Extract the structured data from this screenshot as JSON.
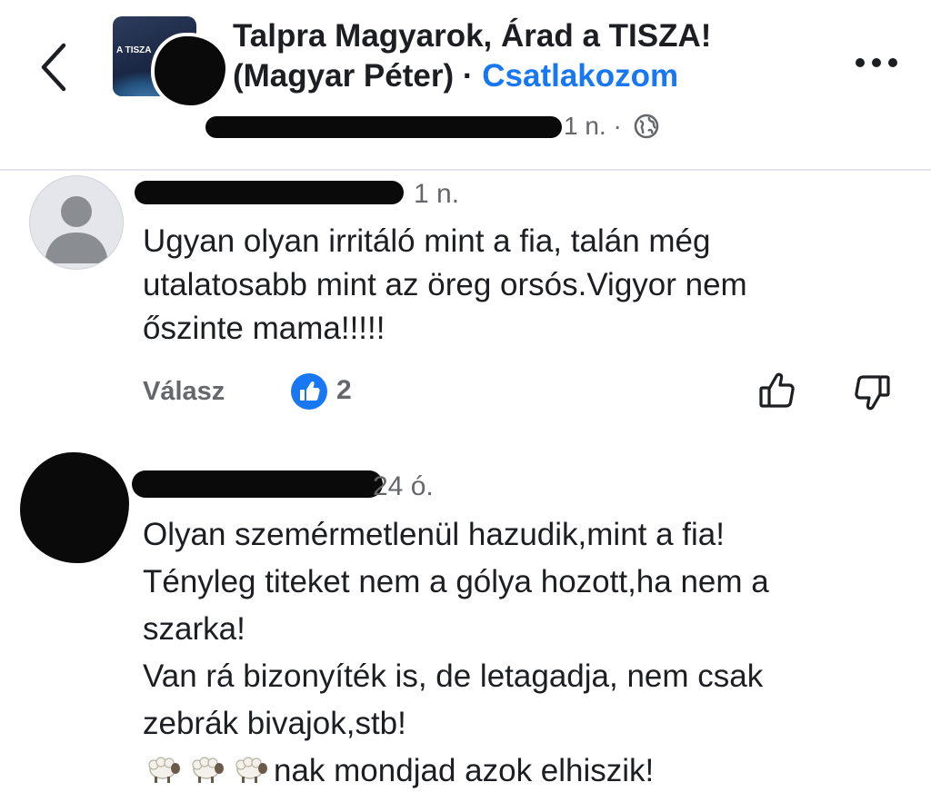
{
  "header": {
    "group_title_line1": "Talpra Magyarok, Árad a TISZA!",
    "group_title_line2": "(Magyar Péter)",
    "separator": " · ",
    "join_label": "Csatlakozom",
    "thumbnail_text": "A TISZA",
    "post_time": "1 n.",
    "meta_separator": " · ",
    "back_icon": "chevron-left-icon",
    "more_icon": "more-horizontal-icon",
    "privacy_icon": "globe-icon"
  },
  "comments": [
    {
      "time": "1 n.",
      "text_lines": [
        "Ugyan olyan irritáló mint a fia, talán még",
        "utalatosabb mint az öreg orsós.Vigyor nem",
        "őszinte mama!!!!!"
      ],
      "reply_label": "Válasz",
      "like_count": "2"
    },
    {
      "time": "24 ó.",
      "text_lines": [
        "Olyan szemérmetlenül hazudik,mint a fia!",
        "Tényleg titeket nem a gólya hozott,ha nem a",
        "szarka!",
        "Van rá bizonyíték is, de letagadja, nem csak",
        "zebrák bivajok,stb!",
        "nak mondjad azok elhiszik!"
      ],
      "emoji": [
        "🐑",
        "🐑",
        "🐑"
      ]
    }
  ],
  "colors": {
    "accent": "#1877f2",
    "text": "#1c1e21",
    "secondary_text": "#65676b",
    "divider": "#e4e6eb"
  }
}
